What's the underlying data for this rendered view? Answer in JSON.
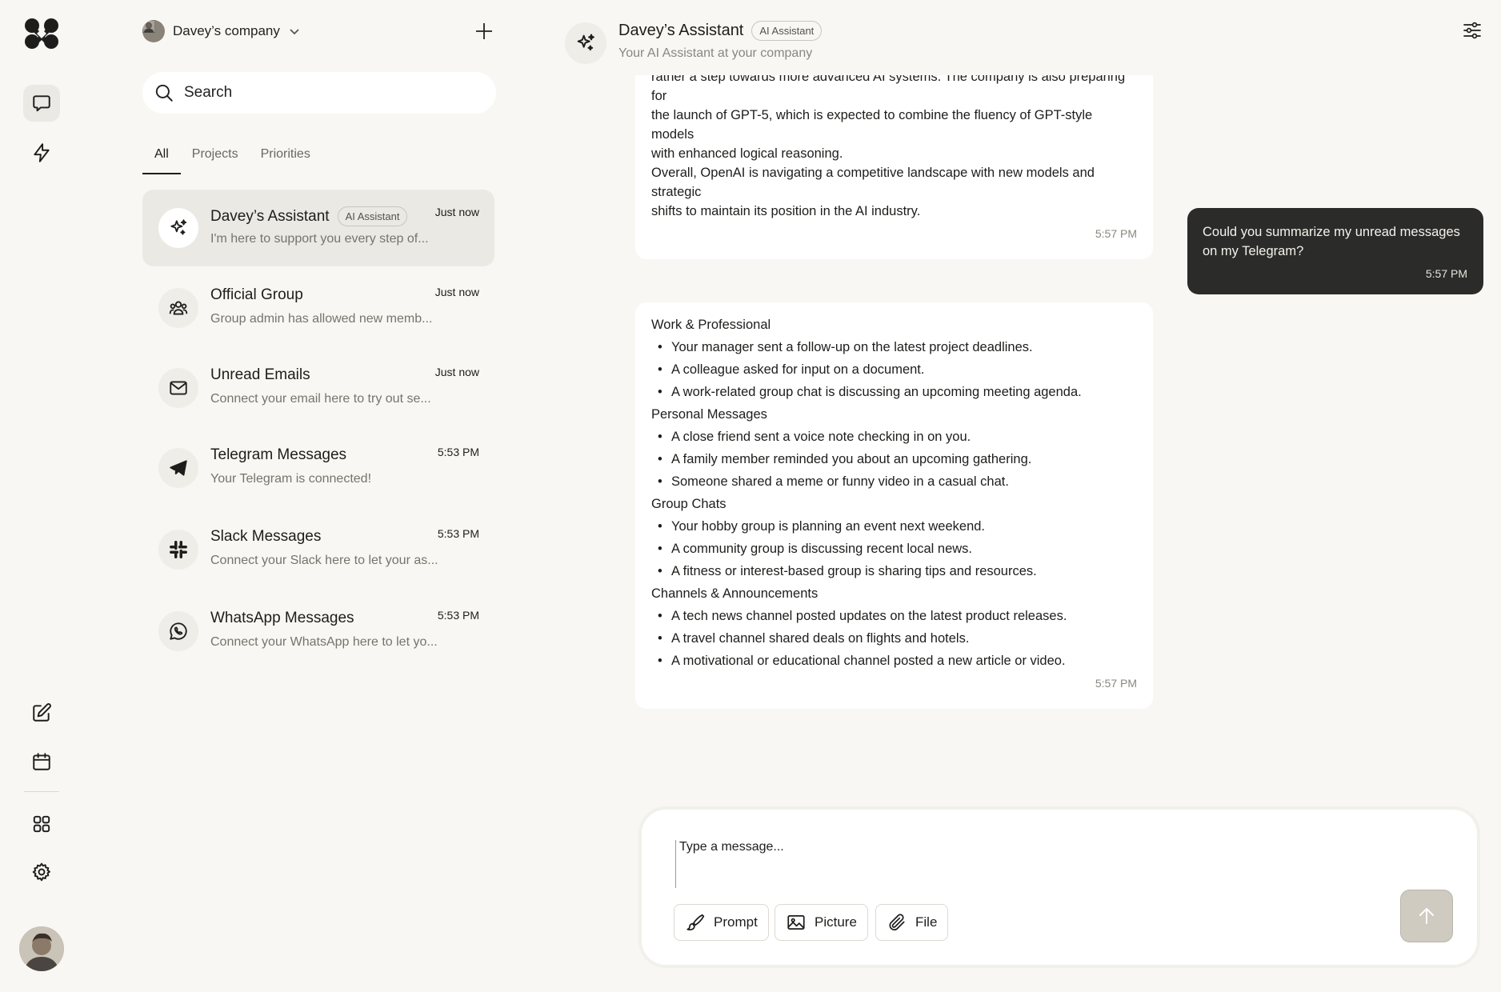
{
  "company": {
    "name": "Davey’s company"
  },
  "search": {
    "placeholder": "Search"
  },
  "tabs": [
    {
      "label": "All",
      "active": true
    },
    {
      "label": "Projects",
      "active": false
    },
    {
      "label": "Priorities",
      "active": false
    }
  ],
  "conversations": [
    {
      "title": "Davey’s Assistant",
      "badge": "AI Assistant",
      "preview": "I'm here to support you every step of...",
      "time": "Just now",
      "icon": "sparkles-icon"
    },
    {
      "title": "Official Group",
      "preview": "Group admin has allowed new memb...",
      "time": "Just now",
      "icon": "group-icon"
    },
    {
      "title": "Unread Emails",
      "preview": "Connect your email here to try out se...",
      "time": "Just now",
      "icon": "mail-icon"
    },
    {
      "title": "Telegram Messages",
      "preview": "Your Telegram is connected!",
      "time": "5:53 PM",
      "icon": "telegram-icon"
    },
    {
      "title": "Slack Messages",
      "preview": "Connect your Slack here to let your as...",
      "time": "5:53 PM",
      "icon": "slack-icon"
    },
    {
      "title": "WhatsApp Messages",
      "preview": "Connect your WhatsApp here to let yo...",
      "time": "5:53 PM",
      "icon": "whatsapp-icon"
    }
  ],
  "chat": {
    "title": "Davey’s Assistant",
    "badge": "AI Assistant",
    "subtitle": "Your AI Assistant at your company",
    "messages": {
      "m1": {
        "lines": [
          "rather a step towards more advanced AI systems. The company is also preparing for",
          "the launch of GPT-5, which is expected to combine the fluency of GPT-style models",
          "with enhanced logical reasoning.",
          "Overall, OpenAI is navigating a competitive landscape with new models and strategic",
          "shifts to maintain its position in the AI industry."
        ],
        "time": "5:57 PM"
      },
      "m2": {
        "lines": [
          "Could you summarize my unread messages",
          "on my Telegram?"
        ],
        "time": "5:57 PM"
      },
      "m3": {
        "sections": [
          {
            "heading": "Work & Professional",
            "items": [
              "Your manager sent a follow-up on the latest project deadlines.",
              "A colleague asked for input on a document.",
              "A work-related group chat is discussing an upcoming meeting agenda."
            ]
          },
          {
            "heading": "Personal Messages",
            "items": [
              "A close friend sent a voice note checking in on you.",
              "A family member reminded you about an upcoming gathering.",
              "Someone shared a meme or funny video in a casual chat."
            ]
          },
          {
            "heading": "Group Chats",
            "items": [
              "Your hobby group is planning an event next weekend.",
              "A community group is discussing recent local news.",
              "A fitness or interest-based group is sharing tips and resources."
            ]
          },
          {
            "heading": "Channels & Announcements",
            "items": [
              "A tech news channel posted updates on the latest product releases.",
              "A travel channel shared deals on flights and hotels.",
              "A motivational or educational channel posted a new article or video."
            ]
          }
        ],
        "time": "5:57 PM"
      }
    }
  },
  "composer": {
    "placeholder": "Type a message...",
    "prompt_label": "Prompt",
    "picture_label": "Picture",
    "file_label": "File"
  }
}
